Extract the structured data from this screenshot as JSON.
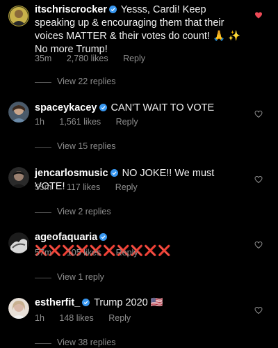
{
  "comments": [
    {
      "username": "itschriscrocker",
      "text": "Yesss, Cardi! Keep speaking up & encouraging them that their voices MATTER & their votes do count! 🙏 ✨ No more Trump!",
      "time": "35m",
      "likes": "2,780 likes",
      "reply": "Reply",
      "view_replies": "View 22 replies",
      "liked": true
    },
    {
      "username": "spaceykacey",
      "text": "CAN'T WAIT TO VOTE",
      "time": "1h",
      "likes": "1,561 likes",
      "reply": "Reply",
      "view_replies": "View 15 replies",
      "liked": false
    },
    {
      "username": "jencarlosmusic",
      "text": "NO JOKE!! We must VOTE!",
      "time": "55m",
      "likes": "117 likes",
      "reply": "Reply",
      "view_replies": "View 2 replies",
      "liked": false
    },
    {
      "username": "ageofaquaria",
      "text": "❌❌❌❌❌❌❌❌❌❌",
      "time": "57m",
      "likes": "105 likes",
      "reply": "Reply",
      "view_replies": "View 1 reply",
      "liked": false
    },
    {
      "username": "estherfit_",
      "text": "Trump 2020 🇺🇸",
      "time": "1h",
      "likes": "148 likes",
      "reply": "Reply",
      "view_replies": "View 38 replies",
      "liked": false
    }
  ],
  "colors": {
    "background": "#000000",
    "text": "#ffffff",
    "meta": "#8e8e8e",
    "verified": "#3897f0",
    "liked_heart": "#ed4956",
    "cross": "#e0202c"
  },
  "icons": {
    "verified": "verified-badge-icon",
    "heart": "heart-icon"
  }
}
